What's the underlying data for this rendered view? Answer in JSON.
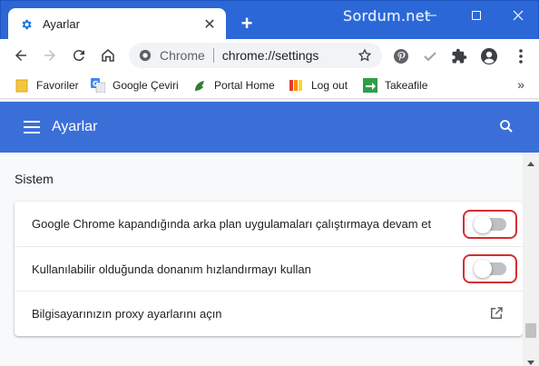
{
  "window": {
    "tab_title": "Ayarlar",
    "new_tab": "+",
    "brand_watermark": "Sordum.net",
    "accent": "#2b67d6"
  },
  "toolbar": {
    "omnibox_chip": "Chrome",
    "omnibox_url": "chrome://settings"
  },
  "bookmarks": {
    "items": [
      {
        "label": "Favoriler",
        "icon": "folder-icon"
      },
      {
        "label": "Google Çeviri",
        "icon": "google-translate-icon"
      },
      {
        "label": "Portal Home",
        "icon": "portal-home-icon"
      },
      {
        "label": "Log out",
        "icon": "log-out-icon"
      },
      {
        "label": "Takeafile",
        "icon": "takeafile-icon"
      }
    ],
    "more": "»"
  },
  "settings": {
    "header_title": "Ayarlar",
    "header_color": "#3b6fd8",
    "section_title": "Sistem",
    "rows": [
      {
        "label": "Google Chrome kapandığında arka plan uygulamaları çalıştırmaya devam et",
        "toggle_on": false
      },
      {
        "label": "Kullanılabilir olduğunda donanım hızlandırmayı kullan",
        "toggle_on": false
      },
      {
        "label": "Bilgisayarınızın proxy ayarlarını açın"
      }
    ]
  }
}
